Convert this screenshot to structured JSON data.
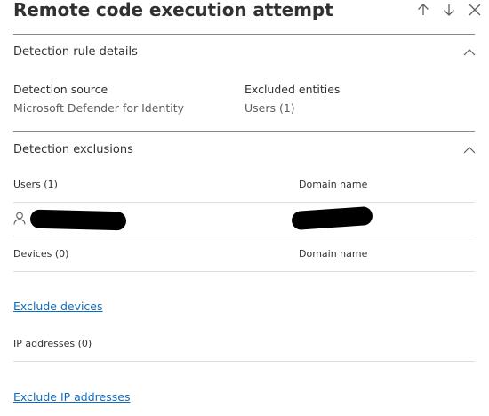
{
  "panel": {
    "title": "Remote code execution attempt",
    "header_icons": [
      "arrow-up-icon",
      "arrow-down-icon",
      "close-icon"
    ]
  },
  "detection_rule_details": {
    "title": "Detection rule details",
    "source_label": "Detection source",
    "source_value": "Microsoft Defender for Identity",
    "excluded_label": "Excluded entities",
    "excluded_value": "Users (1)"
  },
  "detection_exclusions": {
    "title": "Detection exclusions",
    "users_header": "Users (1)",
    "users_domain_header": "Domain name",
    "user_row": {
      "icon": "person-icon",
      "name_redacted": true,
      "domain_redacted": true
    },
    "devices_header": "Devices (0)",
    "devices_domain_header": "Domain name",
    "exclude_devices_link": "Exclude devices",
    "ip_header": "IP addresses (0)",
    "exclude_ip_link": "Exclude IP addresses"
  }
}
